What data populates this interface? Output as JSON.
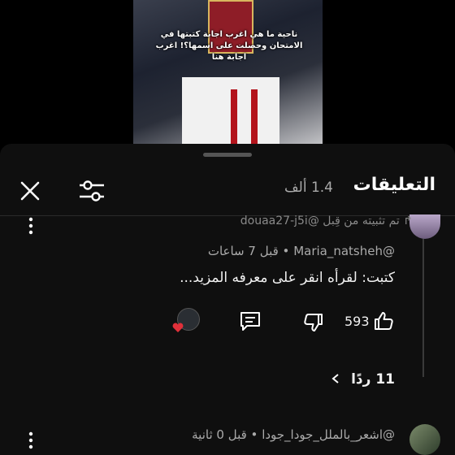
{
  "video": {
    "caption": "ناحية ما هي اغرب اجابة كتبتها في الامتحان وحصلت على اسمها؟! اغرب اجابة هنا"
  },
  "header": {
    "title": "التعليقات",
    "count": "1.4 ألف"
  },
  "comment": {
    "reply_context": "↱ تم تثبيته من قِبل @douaa27-j5i",
    "author": "@Maria_natsheh",
    "time": "قبل 7 ساعات",
    "text": "كتبت: لقرأه انقر على معرفه المزيد...",
    "likes": "593",
    "replies_label": "11 ردًا"
  },
  "next_comment": {
    "author": "@اشعر_بالملل_جودا_جودا",
    "time": "قبل 0 ثانية"
  },
  "colors": {
    "background": "#0f0f0f",
    "heart": "#e0303a"
  },
  "icons": [
    "close-icon",
    "filter-icon",
    "more-vert-icon",
    "thumbs-up-icon",
    "thumbs-down-icon",
    "comment-icon",
    "heart-icon",
    "chevron-left-icon"
  ]
}
